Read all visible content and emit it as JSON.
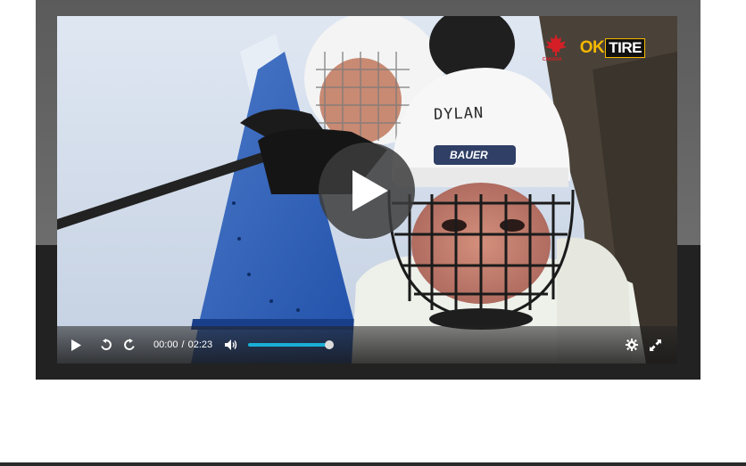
{
  "player": {
    "current_time": "00:00",
    "time_separator": "/",
    "duration": "02:23",
    "volume_level": 0.95,
    "accent_color": "#1aafd6"
  },
  "video_frame": {
    "helmet_text": "DYLAN",
    "helmet_brand": "BAUER",
    "sponsor_logo_ok": "OK",
    "sponsor_logo_tire": "TIRE",
    "hockey_canada_text": "CANADA"
  },
  "icons": {
    "play": "play-icon",
    "rewind": "rewind-icon",
    "fast_forward": "fast-forward-icon",
    "volume": "volume-icon",
    "settings": "gear-icon",
    "fullscreen": "fullscreen-icon"
  }
}
